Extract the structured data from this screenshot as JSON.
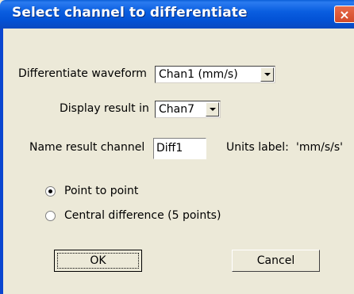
{
  "window": {
    "title": "Select channel to differentiate",
    "close_glyph": "×"
  },
  "form": {
    "differentiate_label": "Differentiate waveform",
    "differentiate_value": "Chan1 (mm/s)",
    "display_label": "Display result in",
    "display_value": "Chan7",
    "name_label": "Name result channel",
    "name_value": "Diff1",
    "units_label": "Units label:",
    "units_value": "'mm/s/s'"
  },
  "method": {
    "options": [
      {
        "label": "Point to point",
        "checked": true
      },
      {
        "label": "Central difference (5 points)",
        "checked": false
      }
    ]
  },
  "buttons": {
    "ok": "OK",
    "cancel": "Cancel"
  }
}
